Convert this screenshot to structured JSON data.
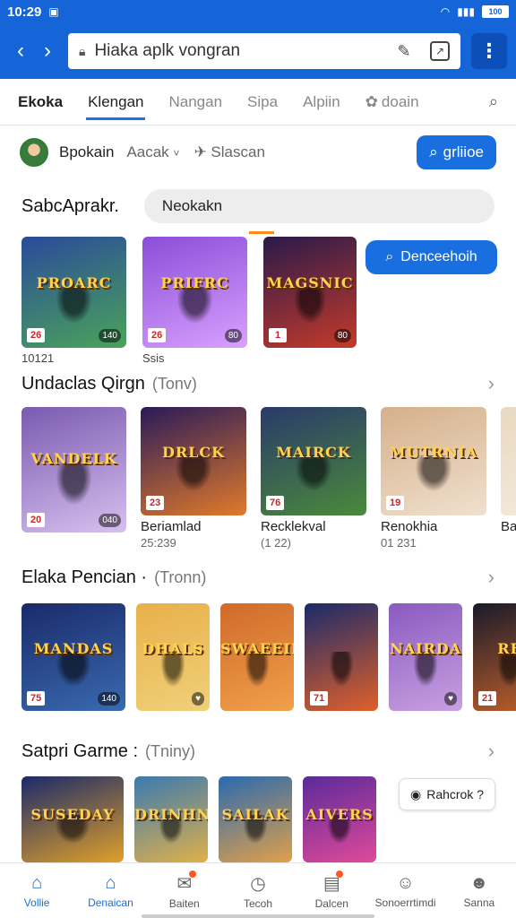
{
  "status": {
    "time": "10:29",
    "battery": "100"
  },
  "browser": {
    "url": "Hiaka aplk vongran",
    "back_icon": "chevron-left-icon",
    "forward_icon": "chevron-right-icon"
  },
  "tabs": [
    {
      "label": "Ekoka"
    },
    {
      "label": "Klengan"
    },
    {
      "label": "Nangan"
    },
    {
      "label": "Sipa"
    },
    {
      "label": "Alpiin"
    },
    {
      "label": "doain"
    }
  ],
  "user": {
    "name": "Bpokain",
    "category": "Aacak",
    "stat": "Slascan",
    "button": "grliioe"
  },
  "search": {
    "label": "SabcAprakr.",
    "value": "Neokakn",
    "float_button": "Denceehoih",
    "caption1": "10121",
    "caption2": "Ssis"
  },
  "search_cards": [
    {
      "title": "PROARC",
      "badge": "26",
      "badge_r": "140",
      "colors": [
        "#2b4a9a",
        "#4aa35a"
      ]
    },
    {
      "title": "PRIFRC",
      "badge": "26",
      "badge_r": "80",
      "colors": [
        "#8a4ed8",
        "#d8a0ff"
      ]
    },
    {
      "title": "MAGSNIC",
      "badge": "1",
      "badge_r": "80",
      "colors": [
        "#2a1a4a",
        "#c43a2a"
      ]
    }
  ],
  "row1": {
    "title": "Undaclas Qirgn",
    "sub": "(Tonv)",
    "items": [
      {
        "title": "VANDELK",
        "badge": "20",
        "badge_r": "040",
        "caption": "",
        "sub": "",
        "colors": [
          "#7a5ab0",
          "#d7c0ef"
        ]
      },
      {
        "title": "DRLCK",
        "badge": "23",
        "badge_r": "",
        "caption": "Beriamlad",
        "sub": "25:239",
        "colors": [
          "#2a1a5a",
          "#e07a2a"
        ]
      },
      {
        "title": "MAIRCK",
        "badge": "76",
        "badge_r": "",
        "caption": "Recklekval",
        "sub": "(1 22)",
        "colors": [
          "#2a3a6a",
          "#4a8a3a"
        ]
      },
      {
        "title": "MUTRNIA",
        "badge": "19",
        "badge_r": "",
        "caption": "Renokhia",
        "sub": "01 231",
        "colors": [
          "#d5b08a",
          "#f0e0cf"
        ]
      },
      {
        "title": "",
        "badge": "",
        "badge_r": "",
        "caption": "Ba",
        "sub": "",
        "colors": [
          "#e8d8c0",
          "#f5ede0"
        ]
      }
    ]
  },
  "row2": {
    "title": "Elaka Pencian ·",
    "sub": "(Tronn)",
    "items": [
      {
        "title": "MANDAS",
        "badge": "75",
        "badge_r": "140",
        "colors": [
          "#1a2a6a",
          "#3a6ab0"
        ]
      },
      {
        "title": "DHALS",
        "badge": "",
        "badge_r": "♥",
        "colors": [
          "#e8b04a",
          "#f0d07a"
        ]
      },
      {
        "title": "SWAEEID",
        "badge": "",
        "badge_r": "",
        "colors": [
          "#d06a2a",
          "#f0a04a"
        ]
      },
      {
        "title": "",
        "badge": "71",
        "badge_r": "",
        "colors": [
          "#1a2a6a",
          "#e0602a"
        ]
      },
      {
        "title": "NAIRDA",
        "badge": "",
        "badge_r": "♥",
        "colors": [
          "#8a5ac0",
          "#c8a0e0"
        ]
      },
      {
        "title": "RE",
        "badge": "21",
        "badge_r": "",
        "colors": [
          "#1a1a2a",
          "#c0602a"
        ]
      }
    ]
  },
  "row3": {
    "title": "Satpri Garme :",
    "sub": "(Tniny)",
    "items": [
      {
        "title": "SUSEDAY",
        "colors": [
          "#1a2a6a",
          "#e0a02a"
        ]
      },
      {
        "title": "DRINHN",
        "colors": [
          "#3a7ab0",
          "#e0b04a"
        ]
      },
      {
        "title": "SAILAK",
        "colors": [
          "#2a6ab0",
          "#e0a04a"
        ]
      },
      {
        "title": "AIVERS",
        "colors": [
          "#5a2a9a",
          "#e04a9a"
        ]
      }
    ],
    "play_button": "Rahcrok ?"
  },
  "bottom_nav": [
    {
      "label": "Vollie",
      "icon": "home-icon"
    },
    {
      "label": "Denaican",
      "icon": "store-icon"
    },
    {
      "label": "Baiten",
      "icon": "inbox-icon"
    },
    {
      "label": "Tecoh",
      "icon": "clock-icon"
    },
    {
      "label": "Dalcen",
      "icon": "calendar-icon"
    },
    {
      "label": "Sonoerrtimdi",
      "icon": "user-group-icon"
    },
    {
      "label": "Sanna",
      "icon": "profile-icon"
    }
  ]
}
